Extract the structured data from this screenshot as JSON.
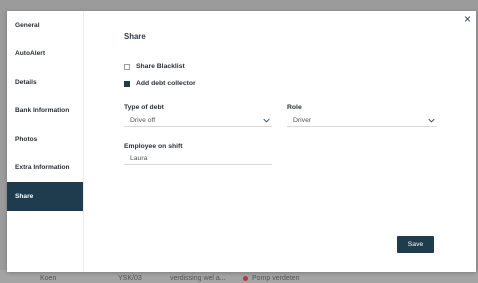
{
  "background_row": {
    "name": "Koen",
    "code": "YSK/03",
    "text": "verdissing wel a...",
    "action": "Pomp verdeten"
  },
  "dialog": {
    "close_glyph": "×",
    "sidebar": {
      "items": [
        {
          "label": "General"
        },
        {
          "label": "AutoAlert"
        },
        {
          "label": "Details"
        },
        {
          "label": "Bank Information"
        },
        {
          "label": "Photos"
        },
        {
          "label": "Extra Information"
        },
        {
          "label": "Share",
          "active": true
        }
      ]
    },
    "share": {
      "title": "Share",
      "share_blacklist": {
        "label": "Share Blacklist",
        "checked": false
      },
      "add_debt_collector": {
        "label": "Add debt collector",
        "checked": true
      },
      "type_of_debt": {
        "label": "Type of debt",
        "value": "Drive off"
      },
      "role": {
        "label": "Role",
        "value": "Driver"
      },
      "employee_on_shift": {
        "label": "Employee on shift",
        "value": "Laura"
      },
      "save_label": "Save"
    }
  },
  "colors": {
    "accent": "#1f3b4e",
    "text": "#2a2f36",
    "overlay": "#9b9b9b"
  }
}
